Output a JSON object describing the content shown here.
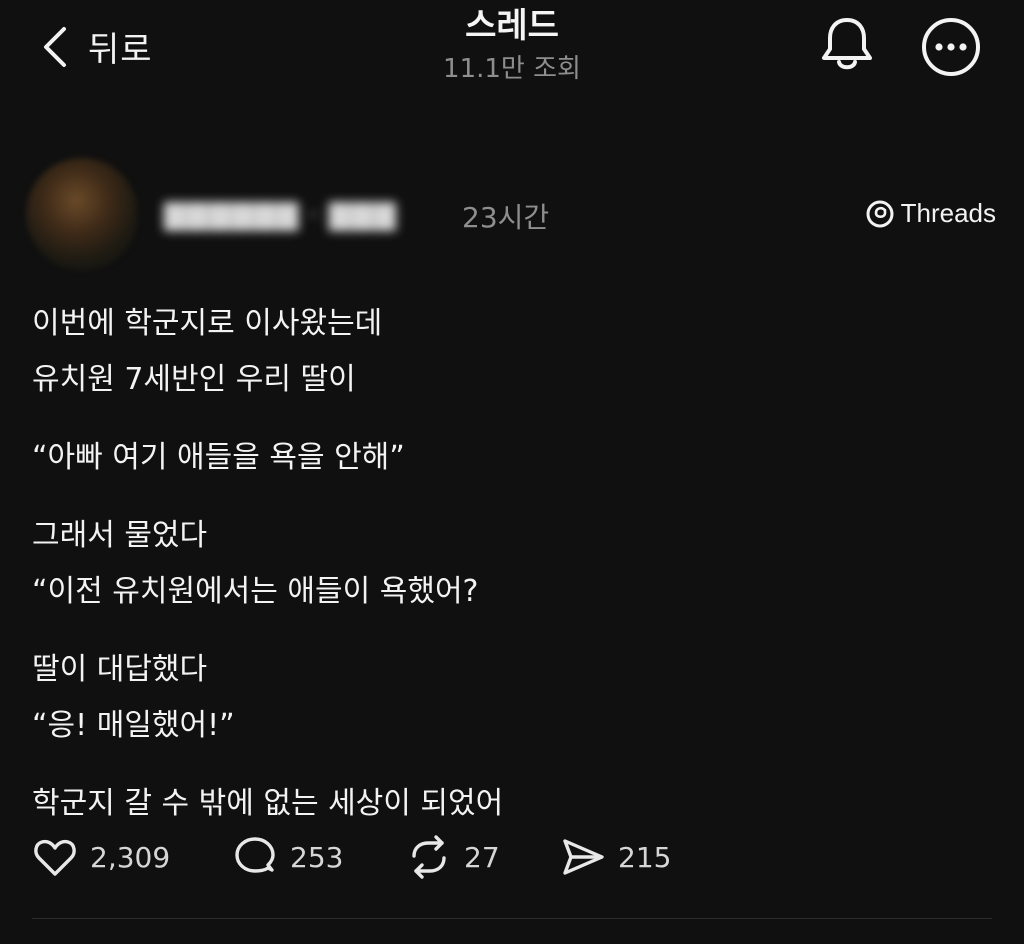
{
  "header": {
    "back_label": "뒤로",
    "title": "스레드",
    "views": "11.1만 조회"
  },
  "author": {
    "time": "23시간",
    "badge": "Threads"
  },
  "post": {
    "paragraphs": [
      [
        "이번에 학군지로 이사왔는데",
        "유치원 7세반인 우리 딸이"
      ],
      [
        "“아빠 여기 애들을 욕을 안해”"
      ],
      [
        "그래서 물었다",
        "“이전 유치원에서는 애들이 욕했어?"
      ],
      [
        "딸이 대답했다",
        "“응! 매일했어!”"
      ],
      [
        "학군지 갈 수 밖에 없는 세상이 되었어"
      ]
    ]
  },
  "actions": {
    "likes": "2,309",
    "comments": "253",
    "reposts": "27",
    "shares": "215"
  },
  "colors": {
    "background": "#101010",
    "text": "#f3f3f3",
    "muted": "#8e8e8e",
    "divider": "#2c2c2c"
  },
  "icons": [
    "chevron-left-icon",
    "bell-icon",
    "more-icon",
    "threads-logo-icon",
    "heart-icon",
    "comment-icon",
    "repost-icon",
    "send-icon"
  ]
}
